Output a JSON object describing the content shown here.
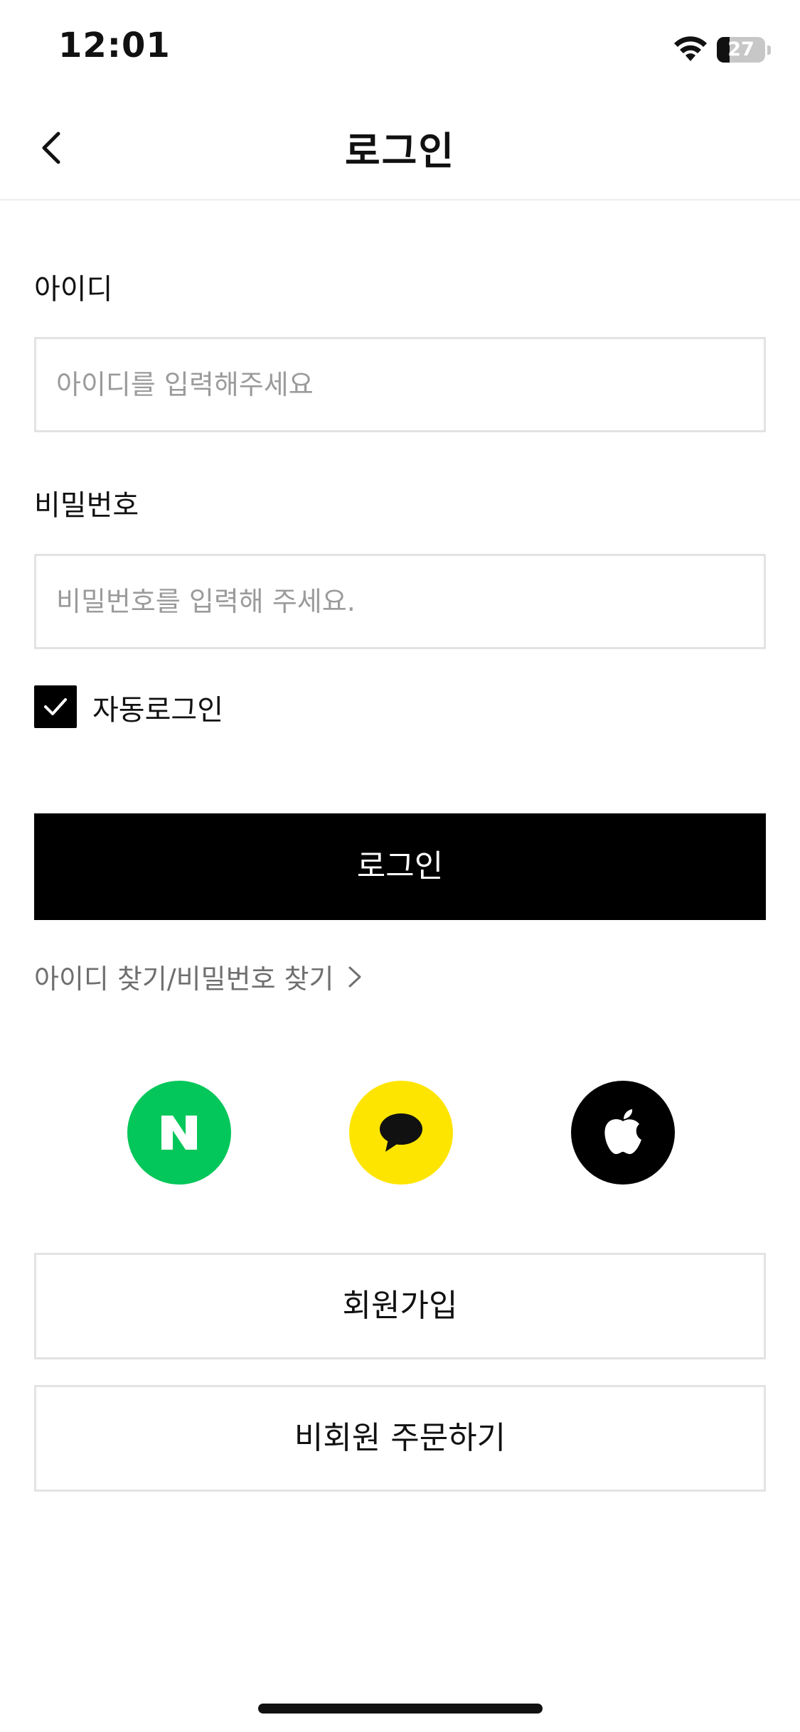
{
  "status_bar": {
    "time": "12:01",
    "battery_level": "27",
    "icons": [
      "wifi-icon",
      "battery-icon"
    ]
  },
  "header": {
    "title": "로그인",
    "back_icon": "chevron-left-icon"
  },
  "form": {
    "id_label": "아이디",
    "id_placeholder": "아이디를 입력해주세요",
    "password_label": "비밀번호",
    "password_placeholder": "비밀번호를 입력해 주세요.",
    "auto_login_label": "자동로그인",
    "auto_login_checked": true,
    "login_button": "로그인",
    "find_link": "아이디 찾기/비밀번호 찾기"
  },
  "social_login": [
    {
      "name": "naver",
      "icon": "naver-n-icon",
      "color": "#03C75A"
    },
    {
      "name": "kakao",
      "icon": "kakao-speech-bubble-icon",
      "color": "#FEE500"
    },
    {
      "name": "apple",
      "icon": "apple-logo-icon",
      "color": "#000000"
    }
  ],
  "bottom_buttons": {
    "signup": "회원가입",
    "guest_order": "비회원 주문하기"
  }
}
